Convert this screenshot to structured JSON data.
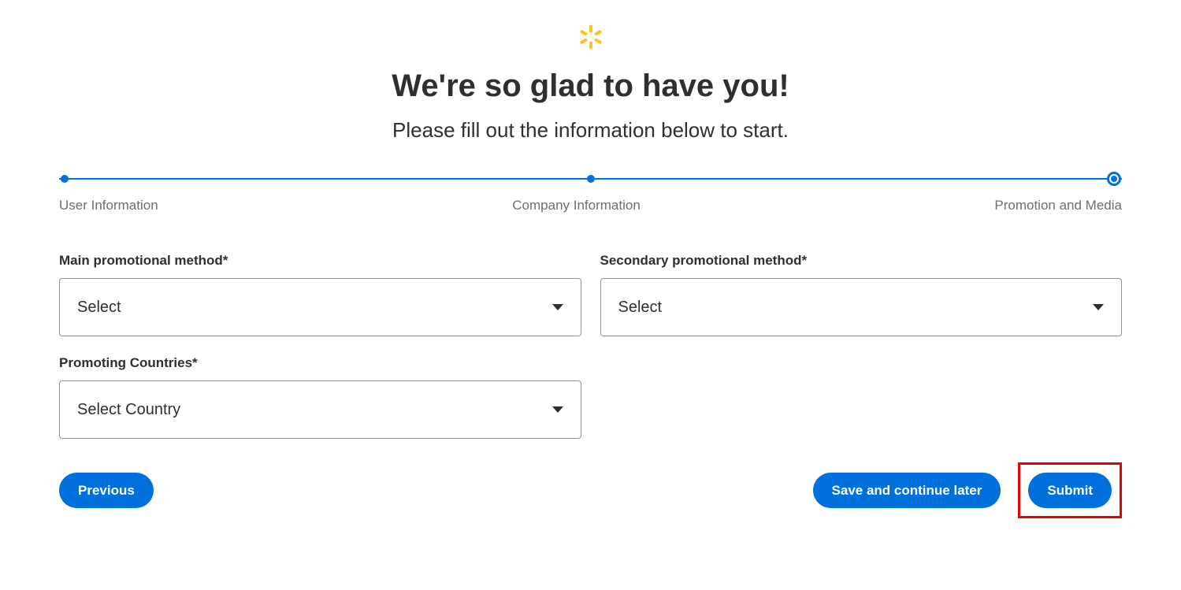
{
  "header": {
    "title": "We're so glad to have you!",
    "subtitle": "Please fill out the information below to start."
  },
  "stepper": {
    "steps": [
      "User Information",
      "Company Information",
      "Promotion and Media"
    ]
  },
  "form": {
    "main_method": {
      "label": "Main promotional method*",
      "value": "Select"
    },
    "secondary_method": {
      "label": "Secondary promotional method*",
      "value": "Select"
    },
    "countries": {
      "label": "Promoting Countries*",
      "value": "Select Country"
    }
  },
  "buttons": {
    "previous": "Previous",
    "save": "Save and continue later",
    "submit": "Submit"
  },
  "colors": {
    "primary": "#0071dc",
    "accent": "#ffc220",
    "highlight": "#e60000"
  }
}
